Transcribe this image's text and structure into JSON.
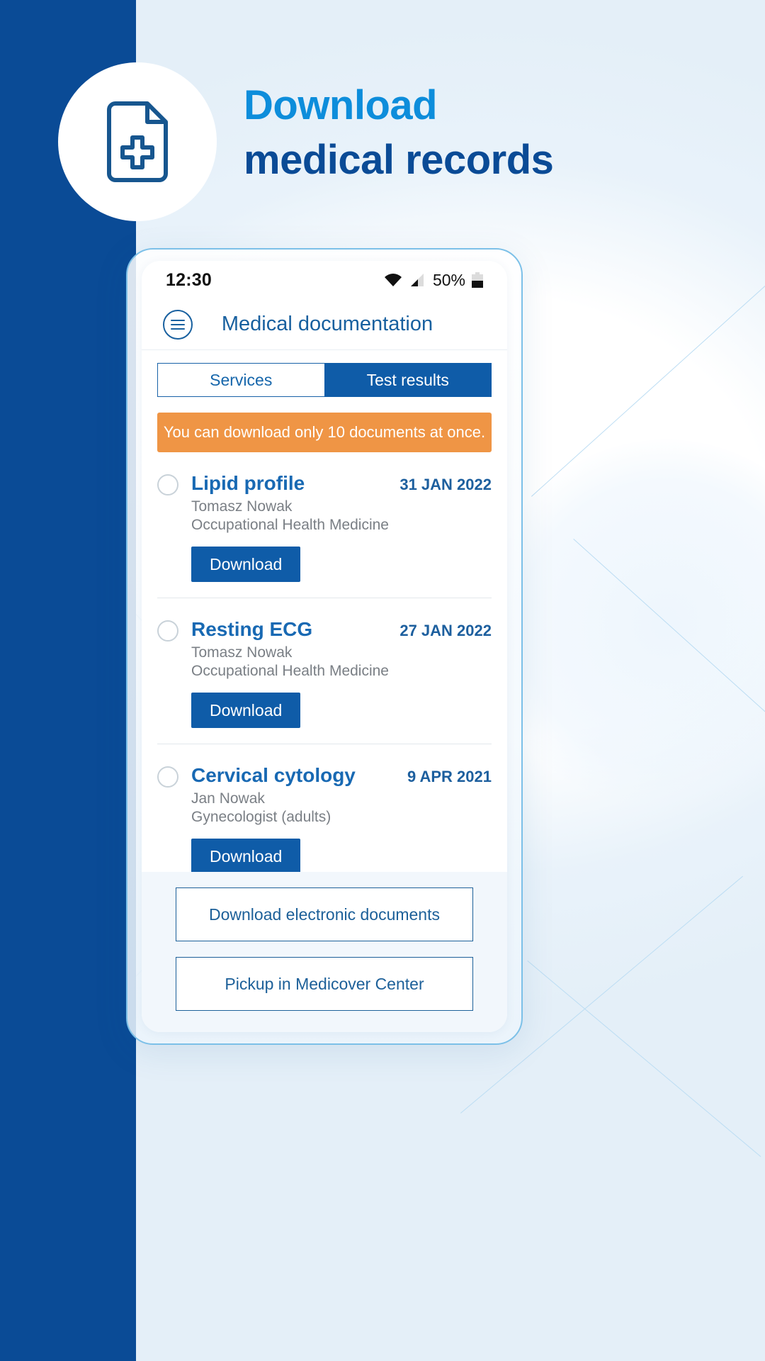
{
  "colors": {
    "brand_dark_blue": "#0a4b96",
    "brand_blue": "#0f5ca8",
    "accent_light_blue": "#0d8ddb",
    "warning_orange": "#ef9545",
    "muted_gray": "#7a7f85"
  },
  "hero": {
    "icon": "document-plus-icon",
    "title_line1": "Download",
    "title_line2": "medical records"
  },
  "phone": {
    "statusbar": {
      "time": "12:30",
      "wifi_icon": "wifi-icon",
      "signal_icon": "cellular-signal-icon",
      "battery_percent": "50%",
      "battery_icon": "battery-half-icon"
    },
    "appbar": {
      "menu_icon": "hamburger-menu-icon",
      "title": "Medical documentation"
    },
    "tabs": [
      {
        "label": "Services",
        "active": false
      },
      {
        "label": "Test results",
        "active": true
      }
    ],
    "banner": {
      "text": "You can download only 10 documents at once."
    },
    "documents": [
      {
        "title": "Lipid profile",
        "date": "31 JAN 2022",
        "person": "Tomasz Nowak",
        "department": "Occupational Health Medicine",
        "download_label": "Download",
        "selected": false
      },
      {
        "title": "Resting ECG",
        "date": "27 JAN 2022",
        "person": "Tomasz Nowak",
        "department": "Occupational Health Medicine",
        "download_label": "Download",
        "selected": false
      },
      {
        "title": "Cervical cytology",
        "date": "9 APR 2021",
        "person": "Jan Nowak",
        "department": "Gynecologist (adults)",
        "download_label": "Download",
        "selected": false
      }
    ],
    "footer": {
      "primary_label": "Download electronic documents",
      "secondary_label": "Pickup in Medicover Center"
    }
  }
}
